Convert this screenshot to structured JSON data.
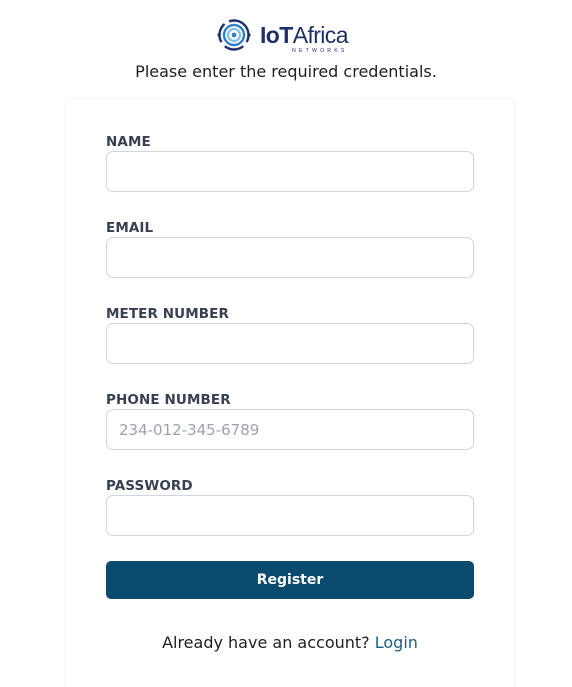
{
  "brand": {
    "name_part1": "IoT",
    "name_part2": "Africa",
    "tagline": "NETWORKS",
    "colors": {
      "dark": "#1e2f6b",
      "ring_blue": "#2f80c9",
      "ring_light": "#7fc0ea"
    }
  },
  "header": {
    "subtitle": "Please enter the required credentials."
  },
  "form": {
    "fields": [
      {
        "label": "NAME",
        "type": "text",
        "value": "",
        "placeholder": ""
      },
      {
        "label": "EMAIL",
        "type": "email",
        "value": "",
        "placeholder": ""
      },
      {
        "label": "METER NUMBER",
        "type": "text",
        "value": "",
        "placeholder": ""
      },
      {
        "label": "PHONE NUMBER",
        "type": "tel",
        "value": "",
        "placeholder": "234-012-345-6789"
      },
      {
        "label": "PASSWORD",
        "type": "password",
        "value": "",
        "placeholder": ""
      }
    ],
    "submit_label": "Register",
    "submit_color": "#0b4a6f"
  },
  "footer": {
    "prompt": "Already have an account?",
    "link_label": "Login",
    "link_color": "#1b5e87"
  }
}
